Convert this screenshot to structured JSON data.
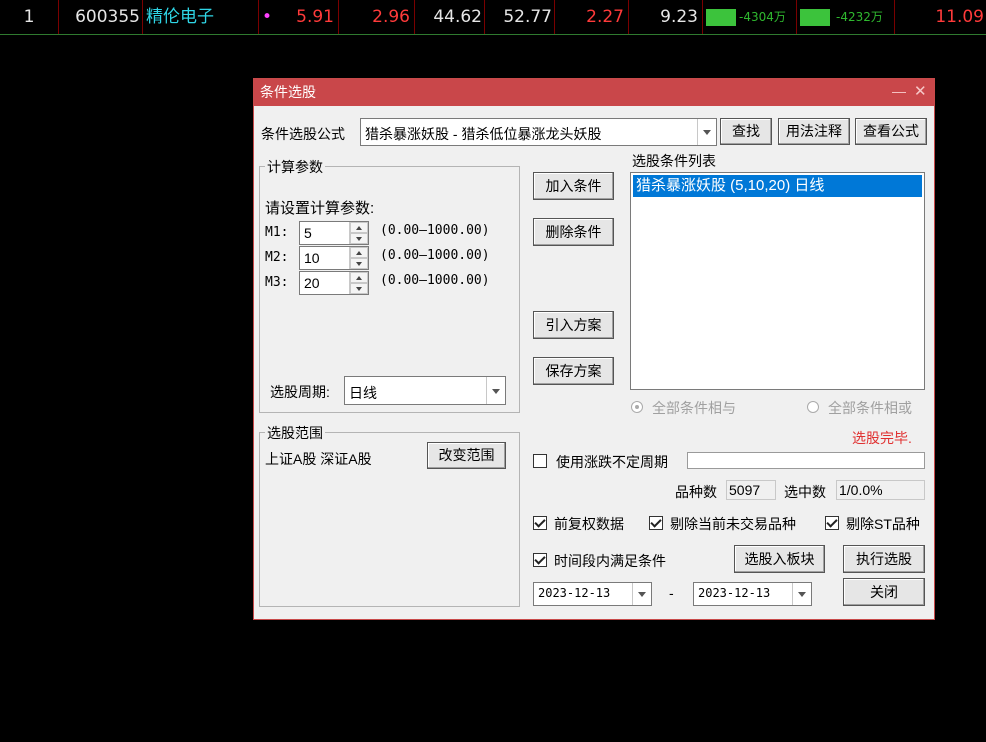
{
  "quote_row": {
    "index": "1",
    "code": "600355",
    "name": "精伦电子",
    "marker": "•",
    "price": "5.91",
    "change_pct": "2.96",
    "v1": "44.62",
    "v2": "52.77",
    "v3": "2.27",
    "v4": "9.23",
    "flow1_label": "-4304万",
    "flow2_label": "-4232万",
    "last": "11.09",
    "colors": {
      "up": "#ff3a3a",
      "name": "#2fd6e6",
      "bar": "#3cc33c"
    }
  },
  "dialog": {
    "title": "条件选股",
    "min_glyph": "—",
    "close_glyph": "✕",
    "formula_label": "条件选股公式",
    "formula_value": "猎杀暴涨妖股 - 猎杀低位暴涨龙头妖股",
    "find_button": "查找",
    "usage_button": "用法注释",
    "view_formula_button": "查看公式",
    "params_group": "计算参数",
    "params_hint": "请设置计算参数:",
    "params": [
      {
        "name": "M1:",
        "value": "5",
        "range": "(0.00—1000.00)"
      },
      {
        "name": "M2:",
        "value": "10",
        "range": "(0.00—1000.00)"
      },
      {
        "name": "M3:",
        "value": "20",
        "range": "(0.00—1000.00)"
      }
    ],
    "period_label": "选股周期:",
    "period_value": "日线",
    "scope_group": "选股范围",
    "scope_value": "上证A股 深证A股",
    "change_scope_button": "改变范围",
    "add_condition_button": "加入条件",
    "delete_condition_button": "删除条件",
    "import_plan_button": "引入方案",
    "save_plan_button": "保存方案",
    "condition_list_label": "选股条件列表",
    "condition_list": [
      "猎杀暴涨妖股 (5,10,20) 日线"
    ],
    "radio_and": "全部条件相与",
    "radio_or": "全部条件相或",
    "status": "选股完毕.",
    "status_color": "#e03030",
    "use_variable_period": "使用涨跌不定周期",
    "variable_period_value": "",
    "count_label": "品种数",
    "count_value": "5097",
    "selected_label": "选中数",
    "selected_value": "1/0.0%",
    "chk_forward_adjust": "前复权数据",
    "chk_exclude_untraded": "剔除当前未交易品种",
    "chk_exclude_st": "剔除ST品种",
    "chk_time_range": "时间段内满足条件",
    "add_to_block_button": "选股入板块",
    "execute_button": "执行选股",
    "close_button": "关闭",
    "date_from": "2023-12-13",
    "date_sep": "-",
    "date_to": "2023-12-13"
  }
}
